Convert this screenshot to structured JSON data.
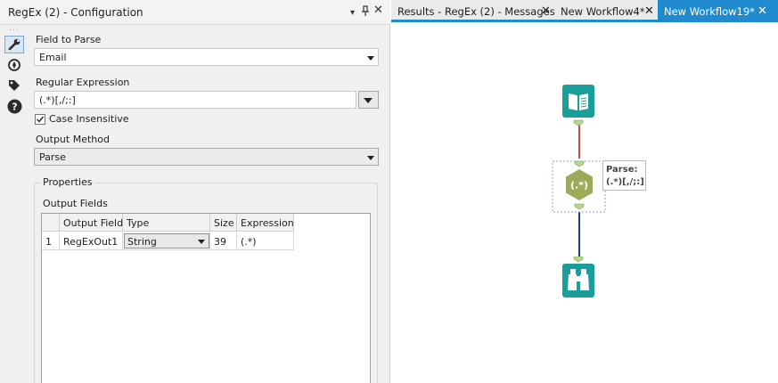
{
  "config_panel": {
    "title": "RegEx (2) - Configuration",
    "dropdown_glyph": "▾",
    "pin_glyph": "▯",
    "close_glyph": "✕",
    "dots": "...",
    "rail_icons": [
      "wrench-icon",
      "compass-icon",
      "tag-icon",
      "help-icon"
    ],
    "field_to_parse_label": "Field to Parse",
    "field_to_parse_value": "Email",
    "regex_label": "Regular Expression",
    "regex_value": "(.*)[,/;:]",
    "case_insensitive_label": "Case Insensitive",
    "case_insensitive_checked": true,
    "output_method_label": "Output Method",
    "output_method_value": "Parse",
    "properties_label": "Properties",
    "output_fields_label": "Output Fields",
    "table": {
      "columns": [
        "",
        "Output Field",
        "Type",
        "Size",
        "Expression"
      ],
      "rows": [
        {
          "index": "1",
          "output_field": "RegExOut1",
          "type": "String",
          "size": "39",
          "expression": "(.*)"
        }
      ]
    }
  },
  "tabs": [
    {
      "label": "Results - RegEx (2) - Messages",
      "close": "✕",
      "active": false
    },
    {
      "label": "New Workflow4*",
      "close": "✕",
      "active": false
    },
    {
      "label": "New Workflow19*",
      "close": "✕",
      "active": true
    }
  ],
  "canvas": {
    "tools": [
      "input-data-tool",
      "regex-tool",
      "browse-tool"
    ],
    "regex_glyph": "(.*)",
    "annotation_line1": "Parse:",
    "annotation_line2": "(.*)[,/;:]",
    "colors": {
      "teal": "#1a9e9a",
      "olive": "#9aab5a",
      "anchor_green": "#b5d88a",
      "conn_red": "#c0504d",
      "conn_blue": "#1f3d7a",
      "selection": "#7fa7d6",
      "active_tab": "#1f8acd"
    }
  }
}
